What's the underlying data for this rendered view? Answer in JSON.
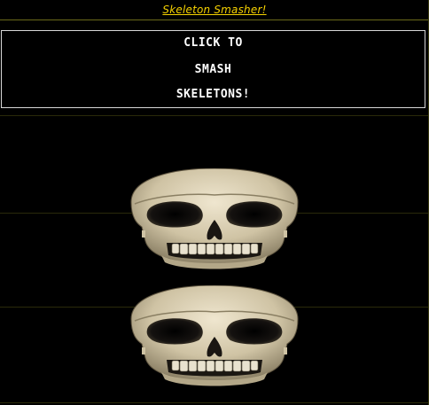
{
  "header": {
    "title_link": "Skeleton Smasher!"
  },
  "instructions": {
    "lines": [
      "CLICK TO",
      "SMASH",
      "SKELETONS!"
    ]
  },
  "game": {
    "skulls": [
      {
        "name": "skull-1"
      },
      {
        "name": "skull-2"
      }
    ]
  },
  "colors": {
    "background": "#000000",
    "link": "#f5d100",
    "text": "#ffffff",
    "box_border": "#d8d8d8",
    "bone": "#d6cbb0"
  }
}
